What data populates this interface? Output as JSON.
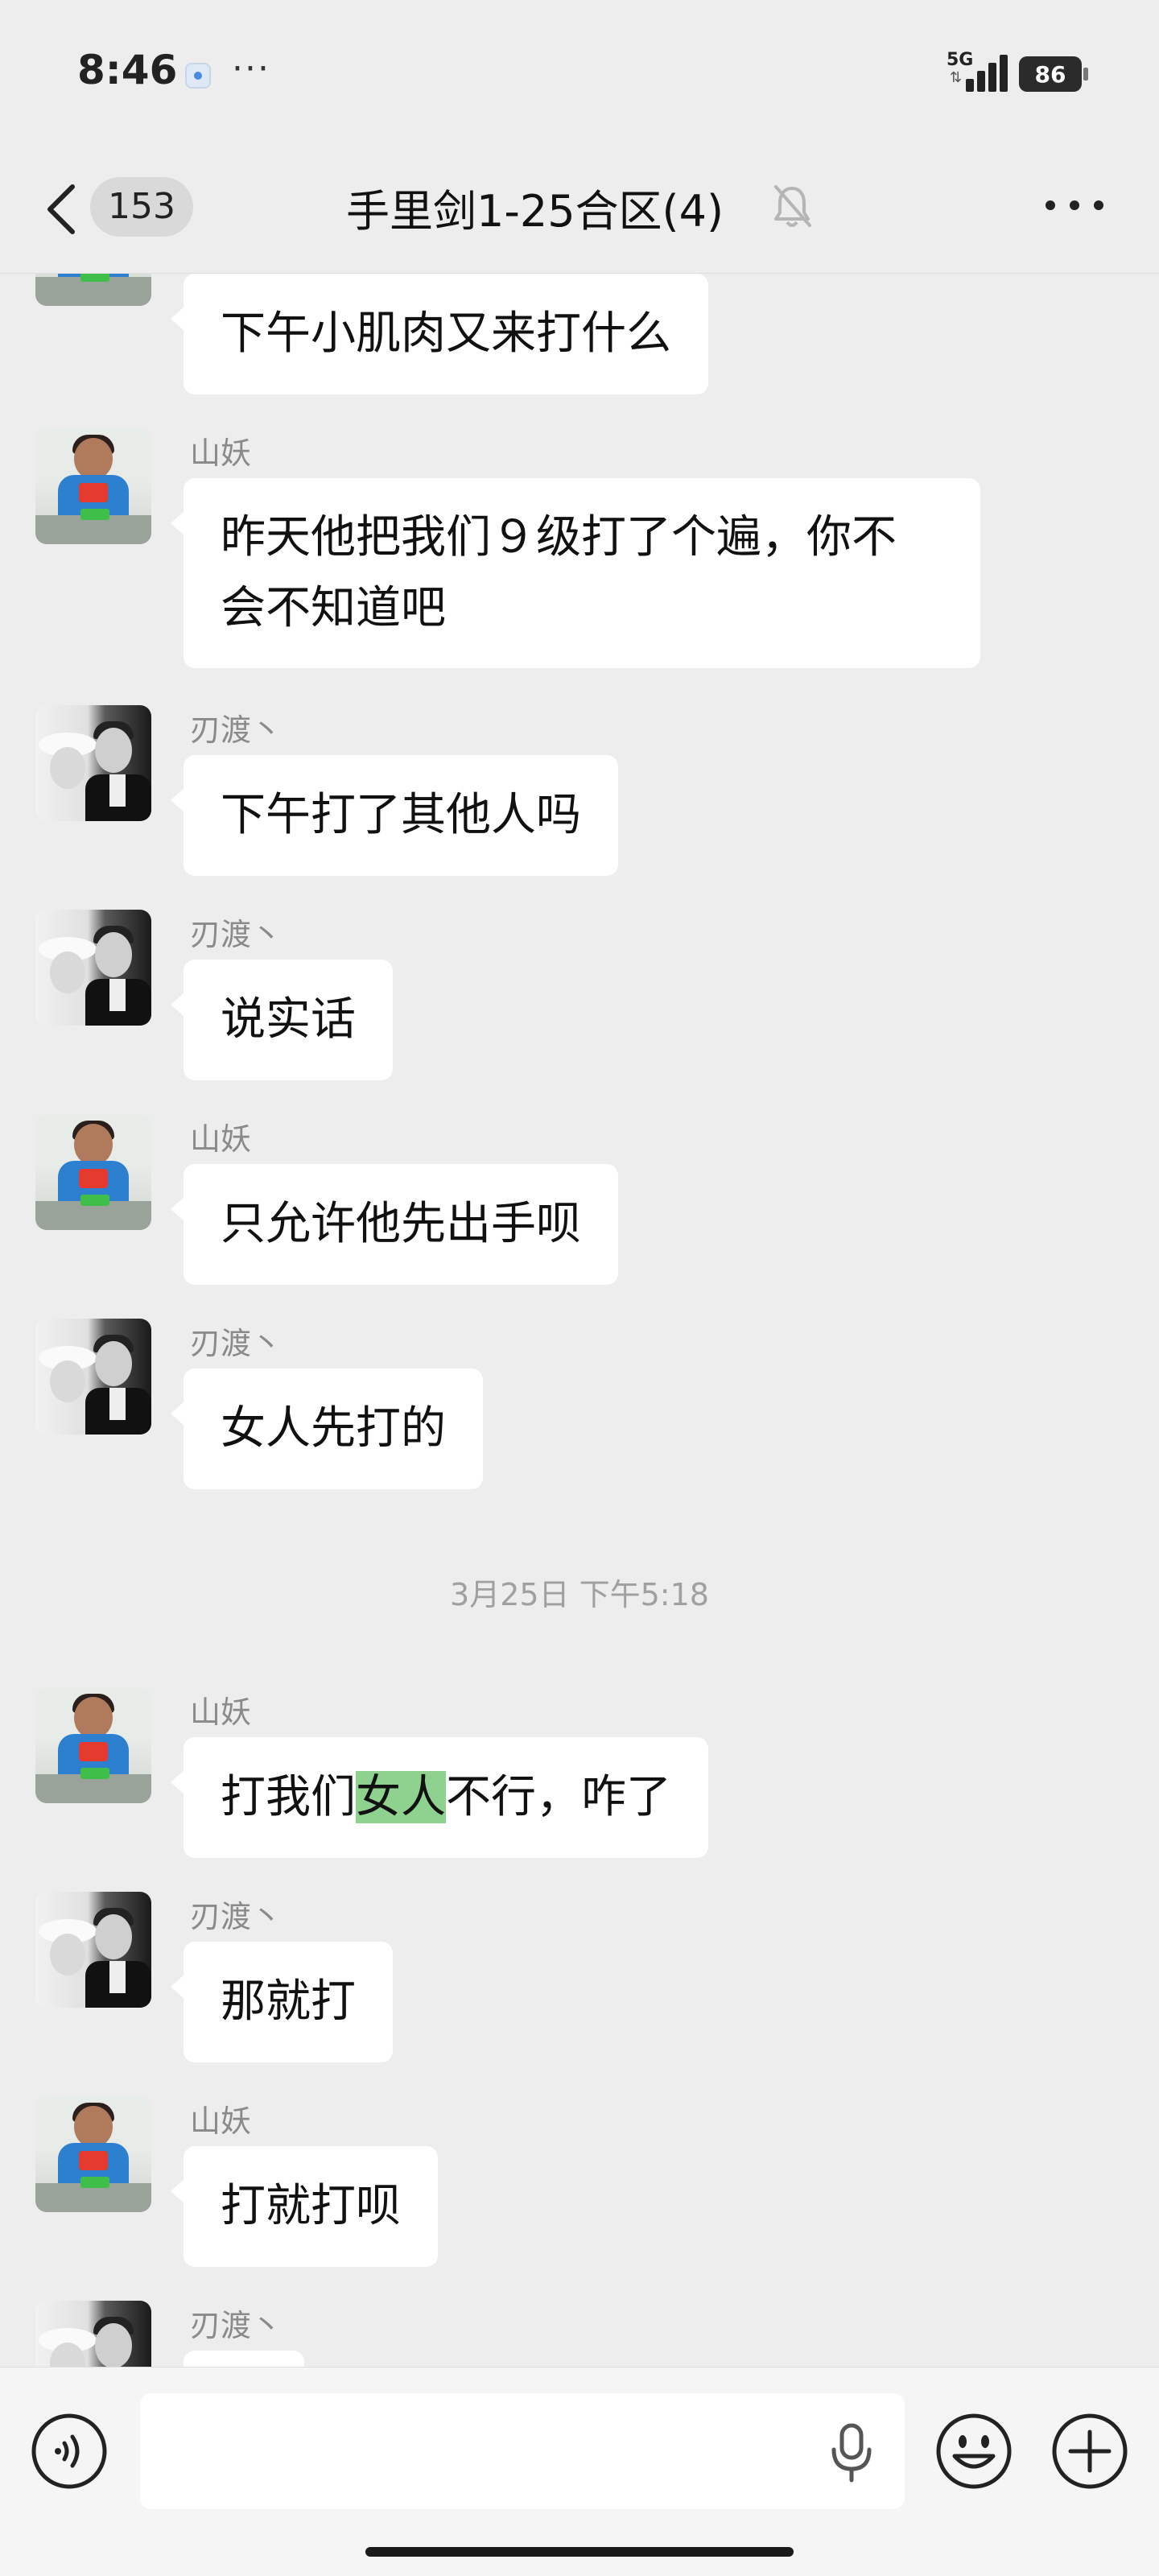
{
  "status_bar": {
    "time": "8:46",
    "more": "···",
    "network": "5G",
    "network_arrows": "⇅",
    "battery": "86"
  },
  "header": {
    "back_icon": "chevron-left-icon",
    "unread_count": "153",
    "title": "手里剑1-25合区(4)",
    "mute_icon": "bell-off-icon",
    "more_icon": "more-horizontal-icon"
  },
  "messages": [
    {
      "sender": "",
      "text": "下午小肌肉又来打什么",
      "avatar": "avatar-boy"
    },
    {
      "sender": "山妖",
      "text_line1": "昨天他把我们９级打了个遍，你不",
      "text_line2": "会不知道吧",
      "avatar": "avatar-boy"
    },
    {
      "sender": "刃渡丶",
      "text": "下午打了其他人吗",
      "avatar": "avatar-couple"
    },
    {
      "sender": "刃渡丶",
      "text": "说实话",
      "avatar": "avatar-couple"
    },
    {
      "sender": "山妖",
      "text": "只允许他先出手呗",
      "avatar": "avatar-boy"
    },
    {
      "sender": "刃渡丶",
      "text": "女人先打的",
      "avatar": "avatar-couple"
    },
    {
      "sender": "山妖",
      "text_before": "打我们",
      "text_highlight": "女人",
      "text_after": "不行，咋了",
      "avatar": "avatar-boy"
    },
    {
      "sender": "刃渡丶",
      "text": "那就打",
      "avatar": "avatar-couple"
    },
    {
      "sender": "山妖",
      "text": "打就打呗",
      "avatar": "avatar-boy"
    },
    {
      "sender": "刃渡丶",
      "text": "",
      "avatar": "avatar-couple"
    }
  ],
  "time_divider": "3月25日 下午5:18",
  "input_bar": {
    "voice_icon": "voice-toggle-icon",
    "input_value": "",
    "mic_icon": "microphone-icon",
    "emoji_icon": "emoji-icon",
    "plus_icon": "plus-icon"
  },
  "colors": {
    "background": "#ededed",
    "bubble": "#ffffff",
    "highlight": "#8fd18f",
    "sender": "#8a8a8a"
  }
}
